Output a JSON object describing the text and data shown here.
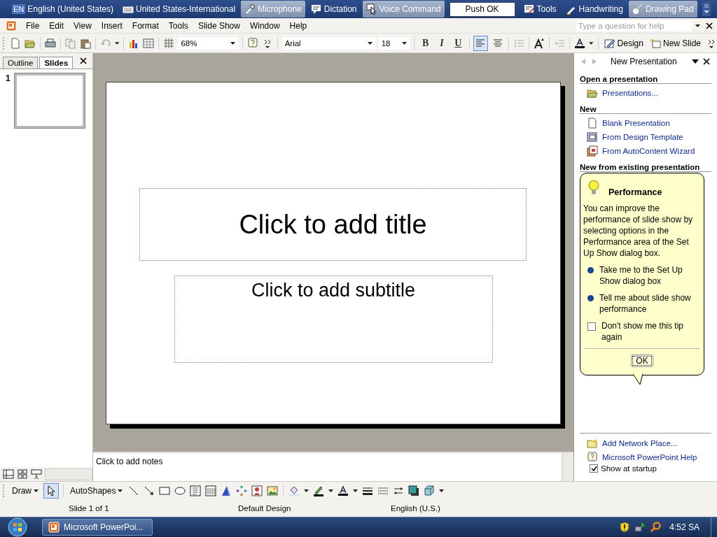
{
  "language_bar": {
    "items": [
      {
        "kind": "badge",
        "badge": "EN",
        "label": "English (United States)",
        "selected": false
      },
      {
        "kind": "tool",
        "label": "United States-International",
        "selected": false
      },
      {
        "kind": "tool",
        "label": "Microphone",
        "selected": true
      },
      {
        "kind": "tool",
        "label": "Dictation",
        "selected": false
      },
      {
        "kind": "tool",
        "label": "Voice Command",
        "selected": true
      },
      {
        "kind": "status",
        "label": "Push OK",
        "selected": false
      },
      {
        "kind": "tool",
        "label": "Tools",
        "selected": false
      },
      {
        "kind": "tool",
        "label": "Handwriting",
        "selected": false
      },
      {
        "kind": "tool",
        "label": "Drawing Pad",
        "selected": true
      }
    ]
  },
  "menu": [
    "File",
    "Edit",
    "View",
    "Insert",
    "Format",
    "Tools",
    "Slide Show",
    "Window",
    "Help"
  ],
  "help_box": {
    "placeholder": "Type a question for help"
  },
  "toolbar": {
    "zoom": "68%",
    "font": "Arial",
    "font_size": "18",
    "text_styles": [
      {
        "kind": "bold",
        "label": "B",
        "on": false
      },
      {
        "kind": "italic",
        "label": "I",
        "on": false
      },
      {
        "kind": "underline",
        "label": "U",
        "on": false
      }
    ],
    "alignments": [
      {
        "kind": "left",
        "selected": true
      },
      {
        "kind": "center",
        "selected": false
      }
    ],
    "buttons": [
      {
        "kind": "design",
        "label": "Design"
      },
      {
        "kind": "new-slide",
        "label": "New Slide"
      }
    ]
  },
  "view_tabs": [
    {
      "label": "Outline",
      "selected": false
    },
    {
      "label": "Slides",
      "selected": true
    }
  ],
  "slides": [
    {
      "number": "1",
      "selected": true
    }
  ],
  "slide": {
    "title_placeholder": "Click to add title",
    "subtitle_placeholder": "Click to add subtitle"
  },
  "notes": {
    "placeholder": "Click to add notes"
  },
  "task_pane": {
    "title": "New Presentation",
    "sections": [
      {
        "heading": "Open a presentation",
        "links": [
          {
            "kind": "folder",
            "label": "Presentations..."
          }
        ]
      },
      {
        "heading": "New",
        "links": [
          {
            "kind": "blank",
            "label": "Blank Presentation"
          },
          {
            "kind": "template",
            "label": "From Design Template"
          },
          {
            "kind": "wizard",
            "label": "From AutoContent Wizard"
          }
        ]
      },
      {
        "heading": "New from existing presentation"
      }
    ],
    "bottom_links": [
      {
        "kind": "network",
        "label": "Add Network Place..."
      },
      {
        "kind": "help",
        "label": "Microsoft PowerPoint Help"
      }
    ],
    "show_at_startup": {
      "label": "Show at startup",
      "checked": true
    }
  },
  "assistant_balloon": {
    "title": "Performance",
    "body": "You can improve the performance of slide show by selecting options in the Performance area of the Set Up Show dialog box.",
    "options": [
      {
        "kind": "bullet",
        "label": "Take me to the Set Up Show dialog box"
      },
      {
        "kind": "bullet",
        "label": "Tell me about slide show performance"
      },
      {
        "kind": "checkbox",
        "label": "Don't show me this tip again",
        "checked": false
      }
    ],
    "button": "OK"
  },
  "drawing_toolbar": {
    "draw_menu": "Draw",
    "autoshapes_menu": "AutoShapes",
    "select_tool": {
      "selected": true
    }
  },
  "status_bar": [
    "Slide 1 of 1",
    "Default Design",
    "English (U.S.)"
  ],
  "taskbar": {
    "app_button": "Microsoft PowerPoi...",
    "clock": "4:52 SA"
  }
}
